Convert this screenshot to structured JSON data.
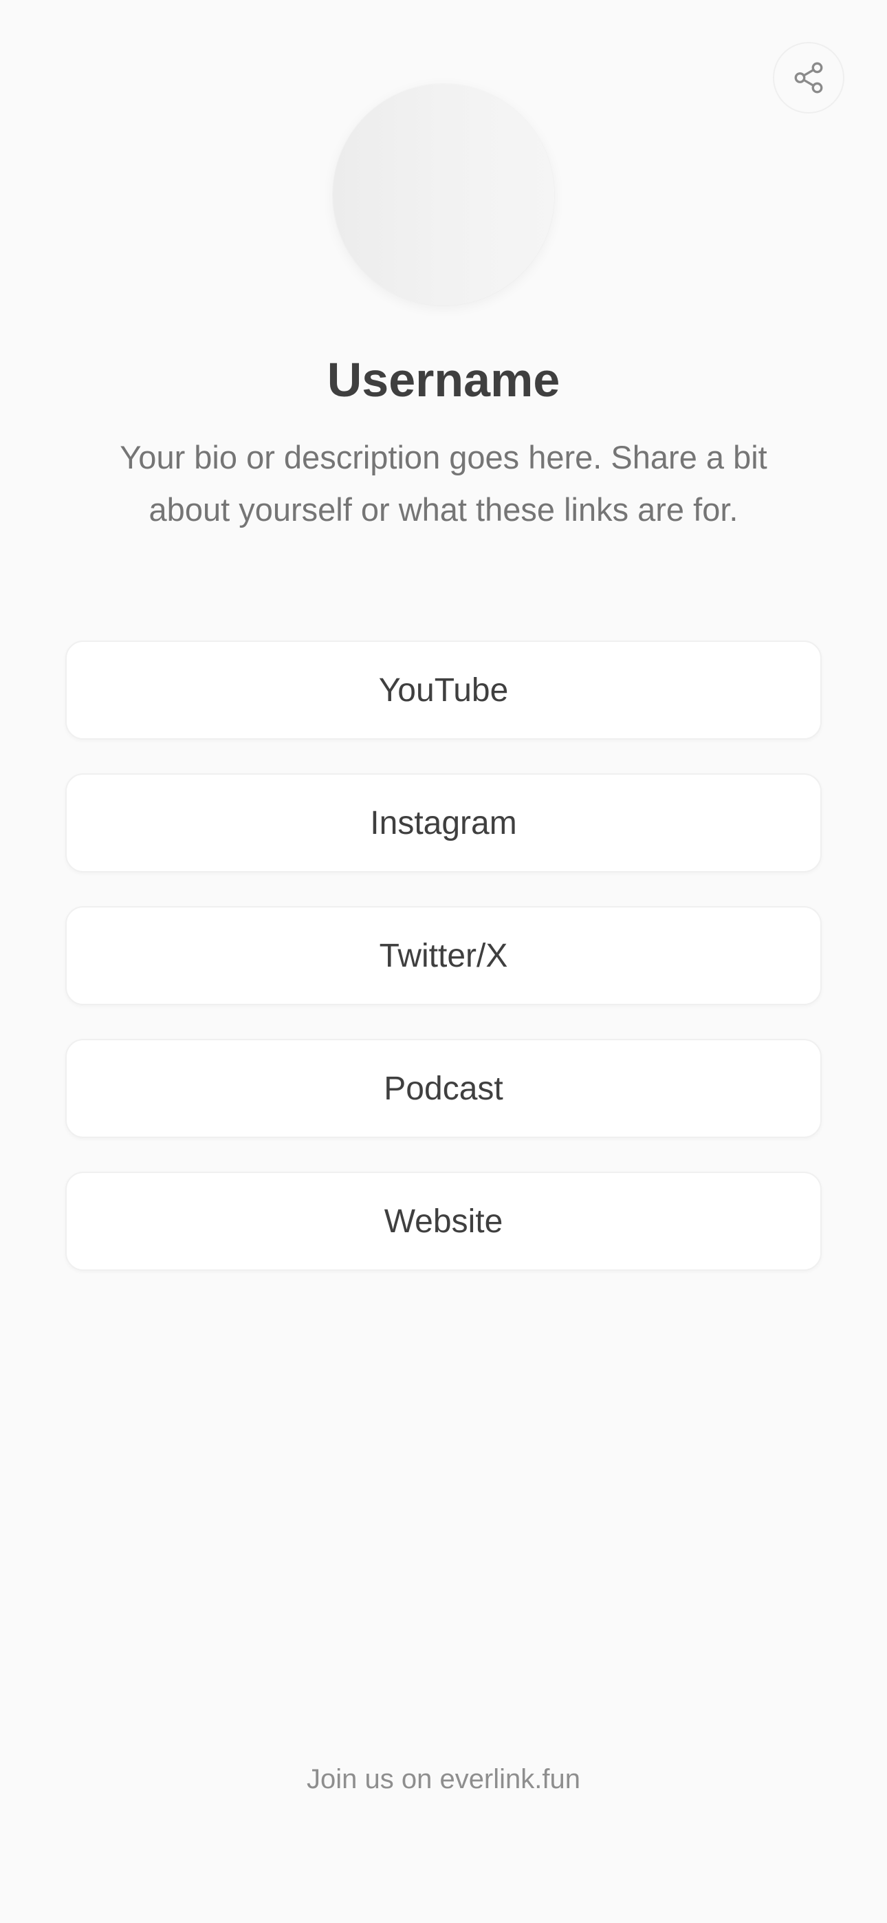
{
  "header": {
    "share_icon": "share-icon"
  },
  "profile": {
    "username": "Username",
    "bio": "Your bio or description goes here. Share a bit about yourself or what these links are for."
  },
  "links": [
    {
      "label": "YouTube"
    },
    {
      "label": "Instagram"
    },
    {
      "label": "Twitter/X"
    },
    {
      "label": "Podcast"
    },
    {
      "label": "Website"
    }
  ],
  "footer": {
    "text": "Join us on everlink.fun"
  },
  "colors": {
    "background": "#fafafa",
    "card": "#ffffff",
    "text_primary": "#3f3f3f",
    "text_secondary": "#757575",
    "text_muted": "#8e8e8e"
  }
}
